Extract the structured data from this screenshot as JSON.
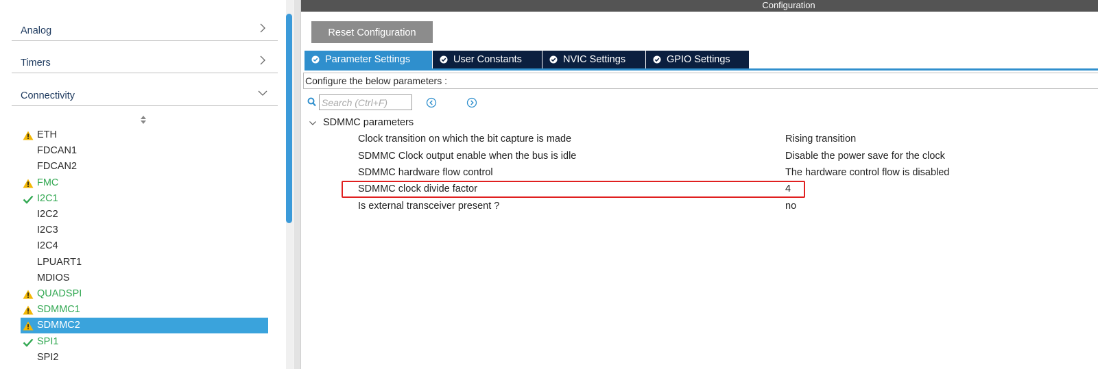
{
  "sidebar": {
    "categories": [
      {
        "label": "Analog",
        "state": "collapsed"
      },
      {
        "label": "Timers",
        "state": "collapsed"
      },
      {
        "label": "Connectivity",
        "state": "expanded"
      }
    ],
    "peripherals": [
      {
        "name": "ETH",
        "status": "warning",
        "color": "plain"
      },
      {
        "name": "FDCAN1",
        "status": "none",
        "color": "plain"
      },
      {
        "name": "FDCAN2",
        "status": "none",
        "color": "plain"
      },
      {
        "name": "FMC",
        "status": "warning",
        "color": "green"
      },
      {
        "name": "I2C1",
        "status": "check",
        "color": "green"
      },
      {
        "name": "I2C2",
        "status": "none",
        "color": "plain"
      },
      {
        "name": "I2C3",
        "status": "none",
        "color": "plain"
      },
      {
        "name": "I2C4",
        "status": "none",
        "color": "plain"
      },
      {
        "name": "LPUART1",
        "status": "none",
        "color": "plain"
      },
      {
        "name": "MDIOS",
        "status": "none",
        "color": "plain"
      },
      {
        "name": "QUADSPI",
        "status": "warning",
        "color": "green"
      },
      {
        "name": "SDMMC1",
        "status": "warning",
        "color": "green"
      },
      {
        "name": "SDMMC2",
        "status": "warning",
        "color": "selected"
      },
      {
        "name": "SPI1",
        "status": "check",
        "color": "green"
      },
      {
        "name": "SPI2",
        "status": "none",
        "color": "plain"
      }
    ]
  },
  "config": {
    "title": "Configuration",
    "reset_label": "Reset Configuration",
    "tabs": [
      {
        "label": "Parameter Settings",
        "active": true
      },
      {
        "label": "User Constants",
        "active": false
      },
      {
        "label": "NVIC Settings",
        "active": false
      },
      {
        "label": "GPIO Settings",
        "active": false
      }
    ],
    "description": "Configure the below parameters :",
    "search_placeholder": "Search (Ctrl+F)",
    "group": "SDMMC parameters",
    "params": [
      {
        "name": "Clock transition on which the bit capture is made",
        "value": "Rising transition"
      },
      {
        "name": "SDMMC Clock output enable when the bus is idle",
        "value": "Disable the power save for the clock"
      },
      {
        "name": "SDMMC hardware flow control",
        "value": "The hardware control flow is disabled"
      },
      {
        "name": "SDMMC clock divide factor",
        "value": "4"
      },
      {
        "name": "Is external transceiver present ?",
        "value": "no"
      }
    ]
  },
  "colors": {
    "accent": "#2f8fcd",
    "selected": "#3aa3dc",
    "tab_dark": "#0b1f3f",
    "green": "#32a852",
    "warning": "#f2b705",
    "highlight": "#e02020"
  },
  "icons": {
    "warning": "warning-triangle-icon",
    "check": "check-icon",
    "search": "search-icon",
    "prev": "circle-chevron-left-icon",
    "next": "circle-chevron-right-icon",
    "tab": "check-circle-icon"
  }
}
